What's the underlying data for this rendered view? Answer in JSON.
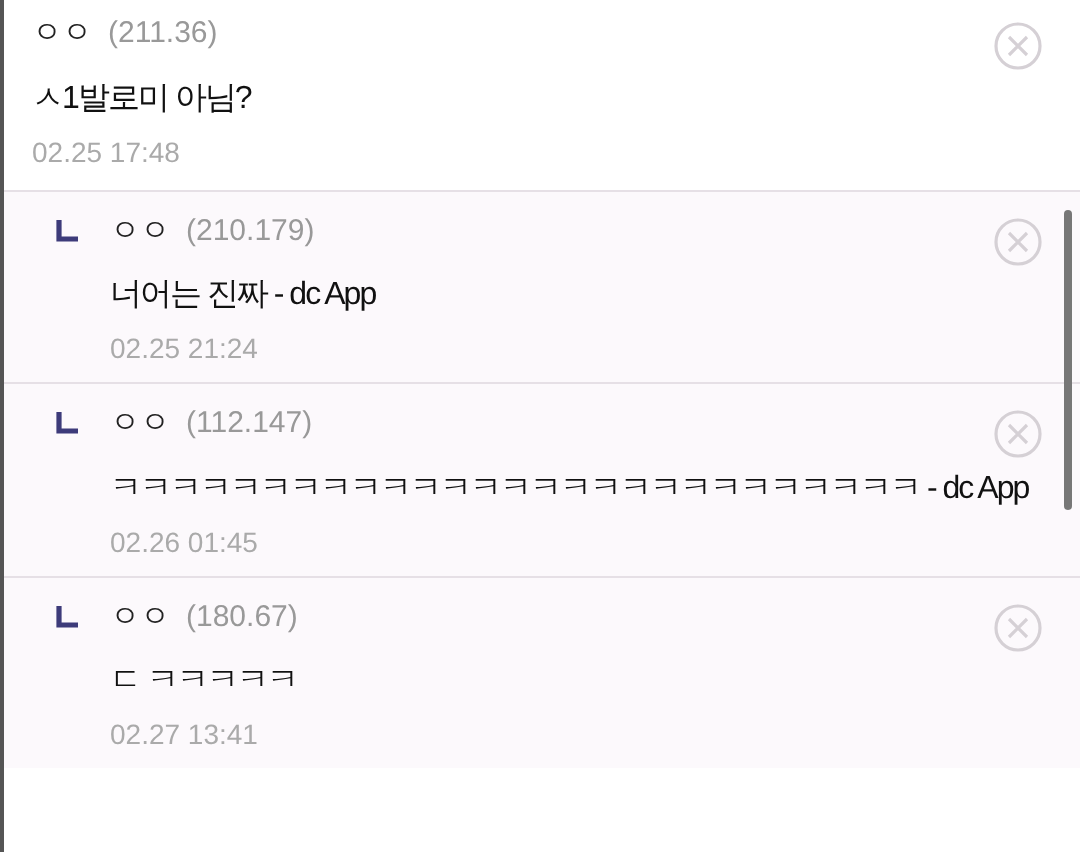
{
  "comments": [
    {
      "kind": "comment",
      "author": "ㅇㅇ",
      "ip": "(211.36)",
      "text": "ㅅ1발로미 아님?",
      "date": "02.25 17:48"
    },
    {
      "kind": "reply",
      "author": "ㅇㅇ",
      "ip": "(210.179)",
      "text": "너어는 진짜 - dc App",
      "date": "02.25 21:24"
    },
    {
      "kind": "reply",
      "author": "ㅇㅇ",
      "ip": "(112.147)",
      "text": "ㅋㅋㅋㅋㅋㅋㅋㅋㅋㅋㅋㅋㅋㅋㅋㅋㅋㅋㅋㅋㅋㅋㅋㅋㅋㅋㅋ - dc App",
      "date": "02.26 01:45"
    },
    {
      "kind": "reply",
      "author": "ㅇㅇ",
      "ip": "(180.67)",
      "text": "ㄷ ㅋㅋㅋㅋㅋ",
      "date": "02.27 13:41"
    }
  ]
}
